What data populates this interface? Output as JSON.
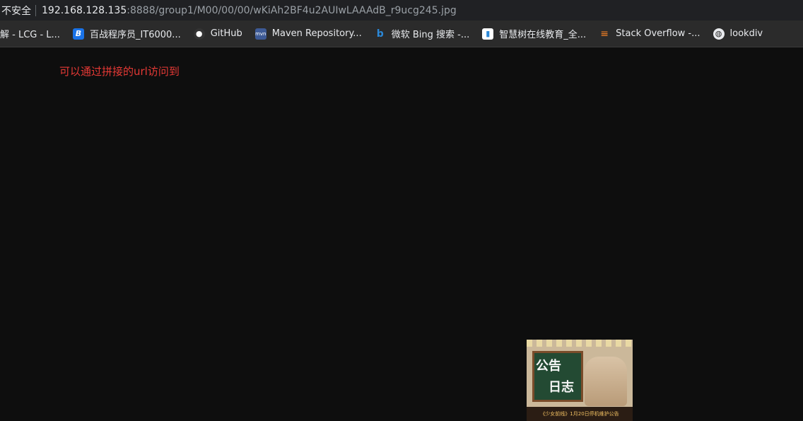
{
  "address_bar": {
    "security_label": "不安全",
    "url_host": "192.168.128.135",
    "url_path": ":8888/group1/M00/00/00/wKiAh2BF4u2AUIwLAAAdB_r9ucg245.jpg"
  },
  "bookmarks": [
    {
      "label": "解 - LCG - L...",
      "icon": "site-icon",
      "color": "#2b2b2b"
    },
    {
      "label": "百战程序员_IT6000...",
      "icon": "baizhan-icon",
      "color": "#1a73e8"
    },
    {
      "label": "GitHub",
      "icon": "github-icon",
      "color": "#333333"
    },
    {
      "label": "Maven Repository...",
      "icon": "maven-icon",
      "color": "#3d5a96"
    },
    {
      "label": "微软 Bing 搜索 -...",
      "icon": "bing-icon",
      "color": "#2b88d8"
    },
    {
      "label": "智慧树在线教育_全...",
      "icon": "zhihuishu-icon",
      "color": "#ffffff"
    },
    {
      "label": "Stack Overflow -...",
      "icon": "stackoverflow-icon",
      "color": "#f48024"
    },
    {
      "label": "lookdiv",
      "icon": "globe-icon",
      "color": "#5f6368"
    }
  ],
  "note_text": "可以通过拼接的url访问到",
  "image": {
    "board_text_1": "公告",
    "board_text_2": "日志",
    "caption": "《少女前线》1月20日停机维护公告"
  }
}
